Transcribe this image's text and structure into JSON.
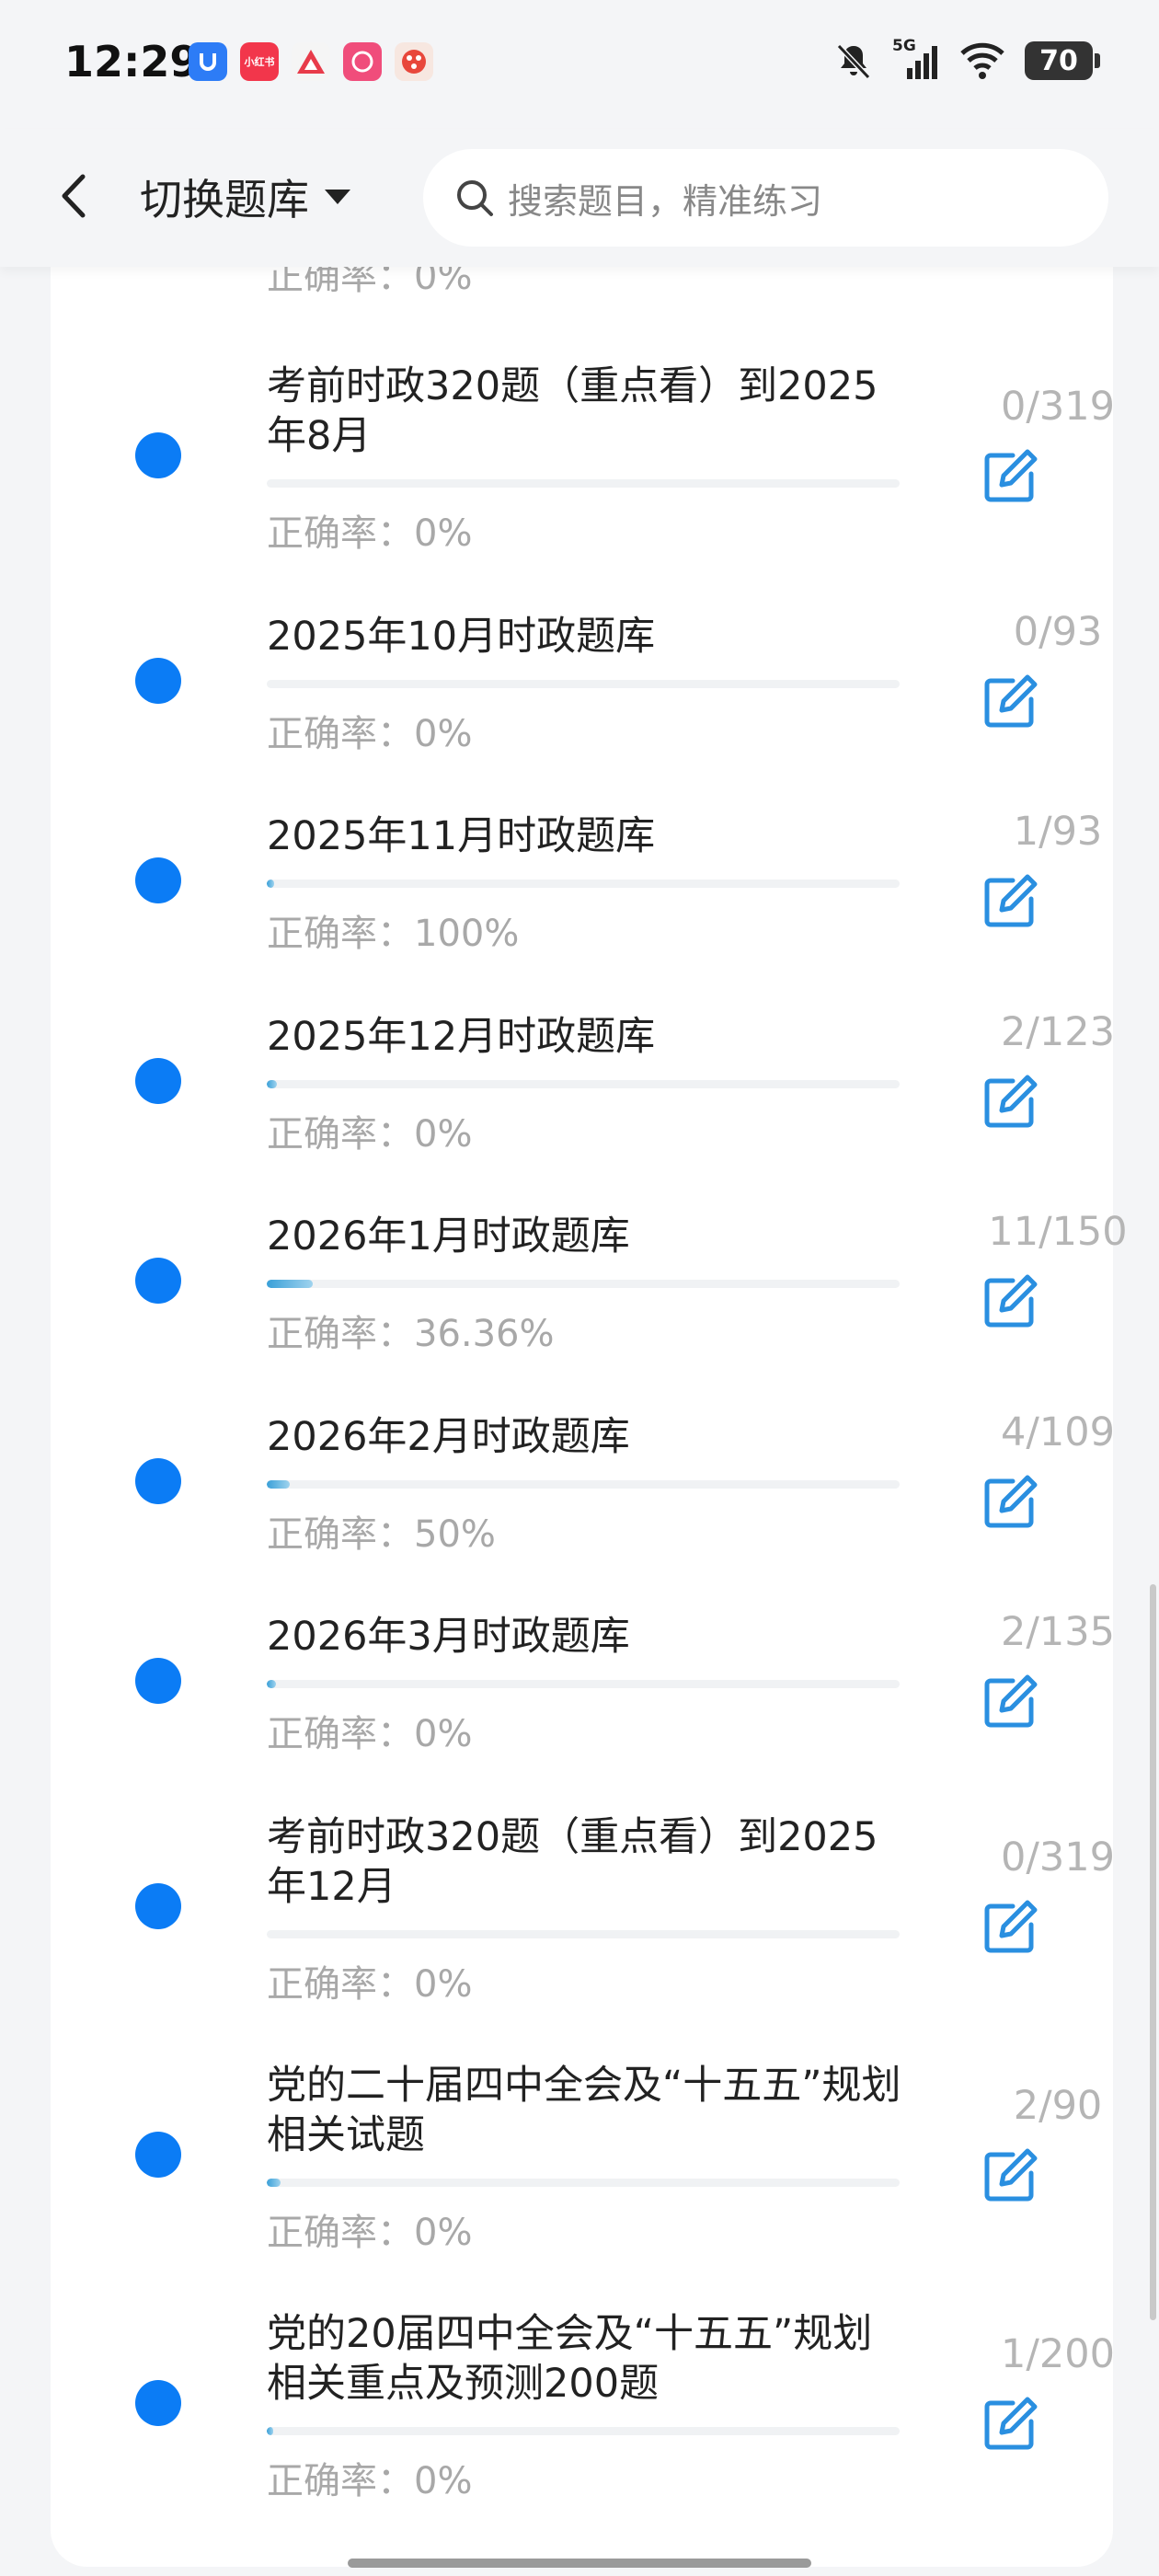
{
  "status_bar": {
    "time": "12:29",
    "network": "5G",
    "battery": "70",
    "apps": [
      {
        "icon": "app-icon-blue",
        "color": "#2d7cf6",
        "label": "U"
      },
      {
        "icon": "xiaohongshu-icon",
        "color": "#f2364b",
        "label": "小红书"
      },
      {
        "icon": "app-icon-red-triangle",
        "color": "#f5f5f5",
        "label": ""
      },
      {
        "icon": "app-icon-pink",
        "color": "#f04d7b",
        "label": ""
      },
      {
        "icon": "app-icon-game",
        "color": "#f26b3a",
        "label": ""
      }
    ]
  },
  "header": {
    "switch_label": "切换题库",
    "search_placeholder": "搜索题目，精准练习"
  },
  "list": {
    "accuracy_prefix": "正确率：",
    "partial_top": {
      "accuracy": "正确率：0%"
    },
    "items": [
      {
        "title": "考前时政320题（重点看）到2025年8月",
        "count": "0/319",
        "accuracy": "正确率：0%",
        "progress": 0.0
      },
      {
        "title": "2025年10月时政题库",
        "count": "0/93",
        "accuracy": "正确率：0%",
        "progress": 0.0
      },
      {
        "title": "2025年11月时政题库",
        "count": "1/93",
        "accuracy": "正确率：100%",
        "progress": 0.011
      },
      {
        "title": "2025年12月时政题库",
        "count": "2/123",
        "accuracy": "正确率：0%",
        "progress": 0.016
      },
      {
        "title": "2026年1月时政题库",
        "count": "11/150",
        "accuracy": "正确率：36.36%",
        "progress": 0.073
      },
      {
        "title": "2026年2月时政题库",
        "count": "4/109",
        "accuracy": "正确率：50%",
        "progress": 0.037
      },
      {
        "title": "2026年3月时政题库",
        "count": "2/135",
        "accuracy": "正确率：0%",
        "progress": 0.015
      },
      {
        "title": "考前时政320题（重点看）到2025年12月",
        "count": "0/319",
        "accuracy": "正确率：0%",
        "progress": 0.0
      },
      {
        "title": "党的二十届四中全会及“十五五”规划相关试题",
        "count": "2/90",
        "accuracy": "正确率：0%",
        "progress": 0.022
      },
      {
        "title": "党的20届四中全会及“十五五”规划相关重点及预测200题",
        "count": "1/200",
        "accuracy": "正确率：0%",
        "progress": 0.005
      }
    ]
  },
  "colors": {
    "dot": "#0b7cf5",
    "edit_icon": "#2a8fe0",
    "progress_start": "#3aa0d8",
    "progress_end": "#9fd3ee"
  }
}
